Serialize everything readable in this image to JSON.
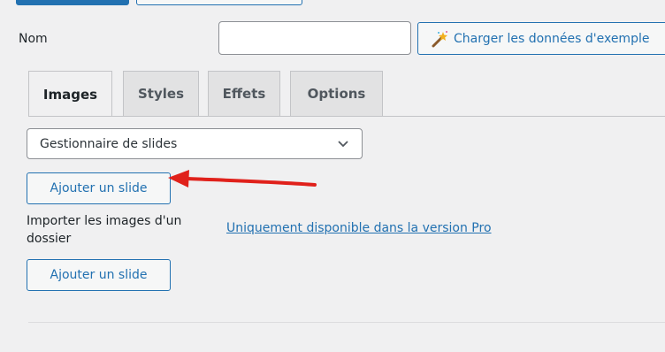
{
  "form": {
    "name_label": "Nom",
    "name_value": "",
    "load_button_label": "Charger les données d'exemple"
  },
  "tabs": [
    {
      "label": "Images",
      "active": true
    },
    {
      "label": "Styles",
      "active": false
    },
    {
      "label": "Effets",
      "active": false
    },
    {
      "label": "Options",
      "active": false
    }
  ],
  "images_panel": {
    "select_value": "Gestionnaire de slides",
    "add_slide_label": "Ajouter un slide",
    "import_label": "Importer les images d'un dossier",
    "pro_link": "Uniquement disponible dans la version Pro",
    "add_slide_label_2": "Ajouter un slide"
  },
  "colors": {
    "accent": "#2271b1",
    "background": "#f0f0f1",
    "annotation_arrow": "#e0211b"
  },
  "icons": {
    "load_button": "magic-wand-icon",
    "select": "chevron-down-icon"
  }
}
